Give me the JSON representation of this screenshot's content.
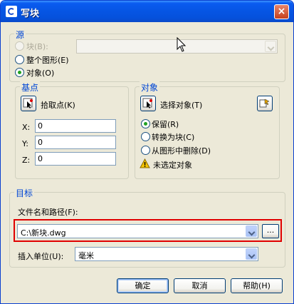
{
  "window": {
    "title": "写块",
    "close_glyph": "×"
  },
  "source": {
    "legend": "源",
    "block_label": "块(B):",
    "block_value": "",
    "entire_drawing_label": "整个图形(E)",
    "objects_label": "对象(O)",
    "selected": "objects"
  },
  "base_point": {
    "legend": "基点",
    "pick_label": "拾取点(K)",
    "x_label": "X:",
    "x_value": "0",
    "y_label": "Y:",
    "y_value": "0",
    "z_label": "Z:",
    "z_value": "0"
  },
  "objects": {
    "legend": "对象",
    "select_label": "选择对象(T)",
    "retain_label": "保留(R)",
    "convert_label": "转换为块(C)",
    "delete_label": "从图形中删除(D)",
    "selected_mode": "retain",
    "status_text": "未选定对象"
  },
  "destination": {
    "legend": "目标",
    "file_label": "文件名和路径(F):",
    "file_value": "C:\\新块.dwg",
    "browse_label": "...",
    "units_label": "插入单位(U):",
    "units_value": "毫米"
  },
  "buttons": {
    "ok": "确定",
    "cancel": "取消",
    "help": "帮助(H)"
  },
  "colors": {
    "title_bar": "#0655e3",
    "group_legend": "#0046d5",
    "highlight": "#e00000",
    "dialog_bg": "#ece9d8"
  }
}
